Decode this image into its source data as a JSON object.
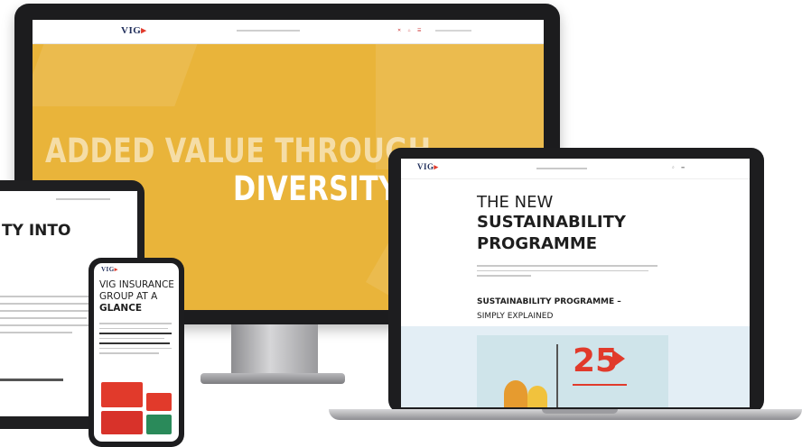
{
  "brand": {
    "logo_text": "VIG",
    "accent_color": "#e13a2b",
    "hero_color": "#e9b43a",
    "navy_color": "#1f2d5a"
  },
  "desktop": {
    "hero_line1": "ADDED VALUE THROUGH",
    "hero_line2": "DIVERSITY"
  },
  "tablet": {
    "heading": "TY INTO"
  },
  "laptop": {
    "title_line1": "THE NEW",
    "title_line2": "SUSTAINABILITY",
    "title_line3": "PROGRAMME",
    "section_title": "SUSTAINABILITY PROGRAMME –",
    "section_subtitle": "SIMPLY EXPLAINED",
    "video_number": "25"
  },
  "phone": {
    "line1": "VIG INSURANCE",
    "line2": "GROUP AT A",
    "line3": "GLANCE"
  }
}
